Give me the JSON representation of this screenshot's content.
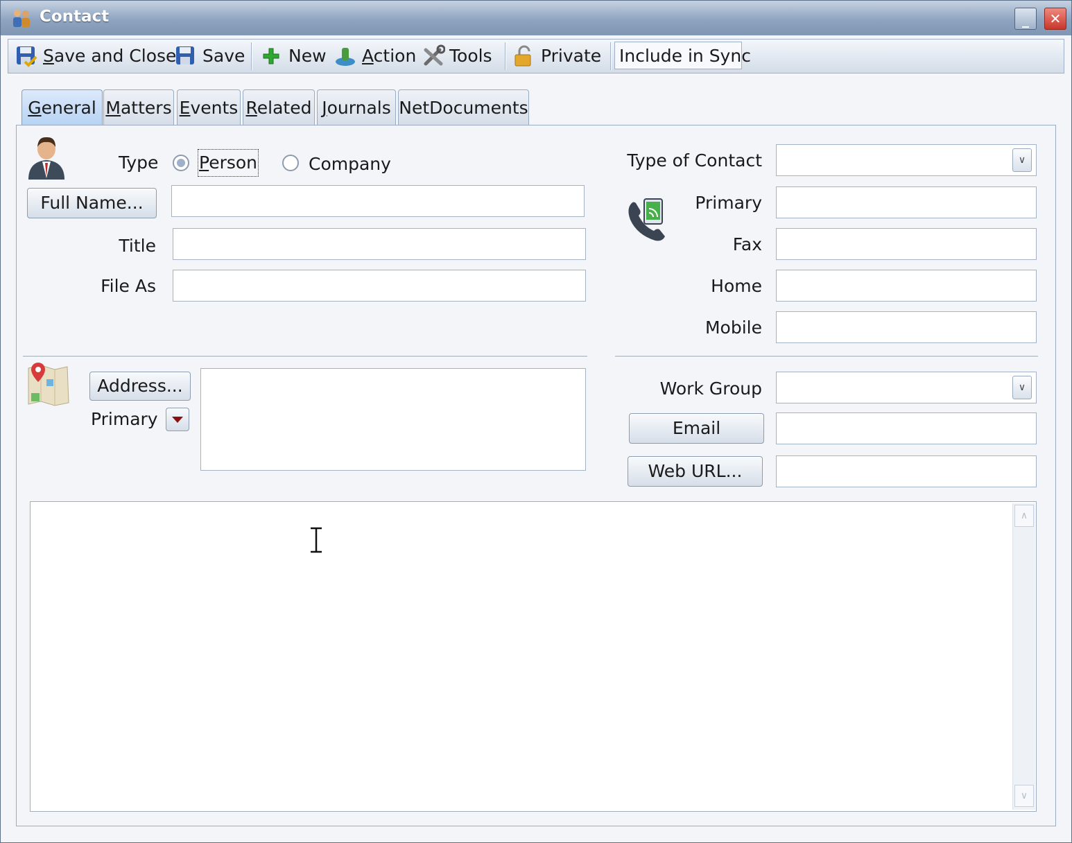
{
  "window": {
    "title": "Contact",
    "icon": "contacts-icon",
    "minimize_symbol": "_",
    "close_symbol": "✕"
  },
  "toolbar": {
    "save_and_close": {
      "mnemonic": "S",
      "rest": "ave and Close",
      "icon": "save-icon"
    },
    "save": "Save",
    "new": "New",
    "action": {
      "mnemonic": "A",
      "rest": "ction"
    },
    "tools": "Tools",
    "private": "Private",
    "include_in_sync": "Include in Sync"
  },
  "tabs": [
    {
      "mnemonic": "G",
      "rest": "eneral",
      "active": true
    },
    {
      "mnemonic": "M",
      "rest": "atters",
      "active": false
    },
    {
      "mnemonic": "E",
      "rest": "vents",
      "active": false
    },
    {
      "mnemonic": "R",
      "rest": "elated",
      "active": false
    },
    {
      "mnemonic": "J",
      "rest": "ournals",
      "active": false
    },
    {
      "label": "NetDocuments",
      "active": false
    }
  ],
  "general": {
    "type_label": "Type",
    "type_options": [
      {
        "mnemonic": "P",
        "rest": "erson",
        "selected": true
      },
      {
        "label": "Company",
        "selected": false
      }
    ],
    "full_name_button": "Full Name...",
    "full_name_value": "",
    "title_label": "Title",
    "title_value": "",
    "file_as_label": "File As",
    "file_as_value": "",
    "address_button": "Address...",
    "address_type": "Primary",
    "address_value": "",
    "type_of_contact_label": "Type of Contact",
    "type_of_contact_value": "",
    "phones": [
      {
        "label": "Primary",
        "value": ""
      },
      {
        "label": "Fax",
        "value": ""
      },
      {
        "label": "Home",
        "value": ""
      },
      {
        "label": "Mobile",
        "value": ""
      }
    ],
    "work_group_label": "Work Group",
    "work_group_value": "",
    "email_button": "Email",
    "email_value": "",
    "web_url_button": "Web URL...",
    "web_url_value": "",
    "notes_value": ""
  },
  "colors": {
    "titlebar": "#8ea4c0",
    "active_tab": "#b6d2f3",
    "close_button": "#d8473a"
  }
}
